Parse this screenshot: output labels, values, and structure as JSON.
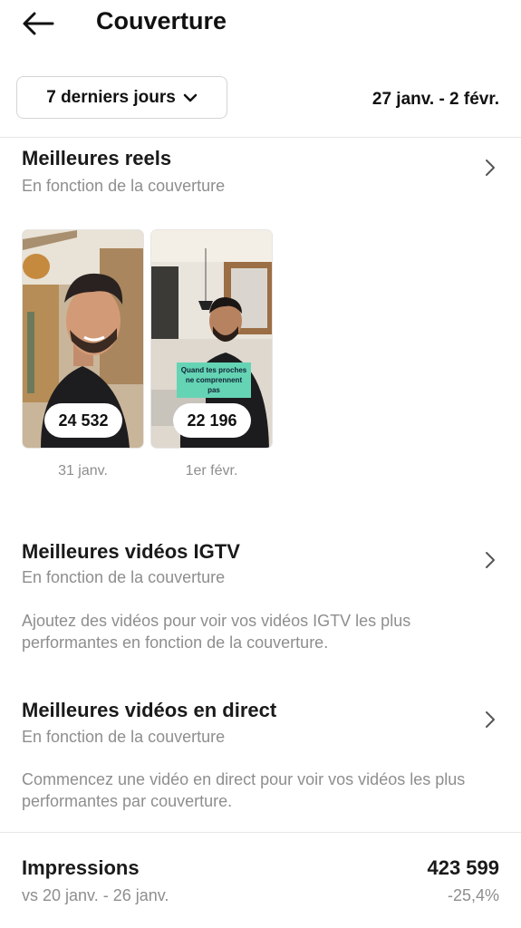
{
  "header": {
    "title": "Couverture",
    "back_icon": "arrow-left-icon"
  },
  "filter": {
    "range_label": "7 derniers jours",
    "date_range": "27 janv. - 2 févr."
  },
  "top_reels": {
    "title": "Meilleures reels",
    "subtitle": "En fonction de la couverture",
    "items": [
      {
        "count": "24 532",
        "date": "31 janv."
      },
      {
        "count": "22 196",
        "date": "1er févr.",
        "caption": "Quand tes proches ne comprennent pas"
      }
    ]
  },
  "igtv": {
    "title": "Meilleures vidéos IGTV",
    "subtitle": "En fonction de la couverture",
    "description": "Ajoutez des vidéos pour voir vos vidéos IGTV les plus performantes en fonction de la couverture."
  },
  "live": {
    "title": "Meilleures vidéos en direct",
    "subtitle": "En fonction de la couverture",
    "description": "Commencez une vidéo en direct pour voir vos vidéos les plus performantes par couverture."
  },
  "impressions": {
    "title": "Impressions",
    "value": "423 599",
    "comparison": "vs 20 janv. - 26 janv.",
    "delta": "-25,4%"
  }
}
